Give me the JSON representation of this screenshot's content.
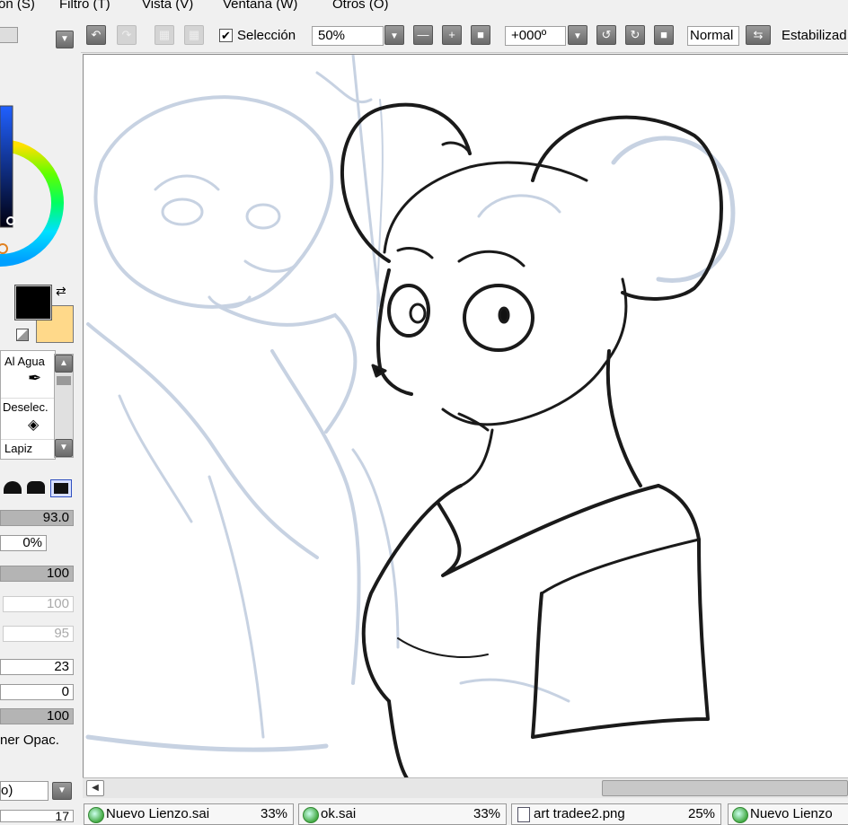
{
  "menu": [
    "ón (S)",
    "Filtro (T)",
    "Vista (V)",
    "Ventana (W)",
    "Otros (O)"
  ],
  "toolbar": {
    "selection_label": "Selección",
    "selection_checked": true,
    "zoom_value": "50%",
    "rotation_value": "+000º",
    "blend_mode": "Normal",
    "stabilizer_label": "Estabilizad"
  },
  "tools": {
    "al_agua": "Al Agua",
    "deselec": "Deselec.",
    "lapiz": "Lapiz"
  },
  "colors": {
    "primary": "#000000",
    "secondary": "#ffd98a",
    "stroke": "#1a1a1a",
    "sketch": "#c7d2e2"
  },
  "brush": {
    "size": "93.0",
    "size_level": 1.0,
    "min_size": "0%",
    "density": "100",
    "density_level": 1.0,
    "val_a": "100",
    "val_b": "95",
    "val_c": "23",
    "val_d": "0",
    "val_e": "100",
    "val_e_level": 1.0,
    "keep_opacity": "ner Opac.",
    "dropdown_value": "o)",
    "bottom_value": "17"
  },
  "tabs": [
    {
      "name": "Nuevo Lienzo.sai",
      "percent": "33%"
    },
    {
      "name": "ok.sai",
      "percent": "33%"
    },
    {
      "name": "art tradee2.png",
      "percent": "25%"
    },
    {
      "name": "Nuevo Lienzo",
      "percent": ""
    }
  ]
}
